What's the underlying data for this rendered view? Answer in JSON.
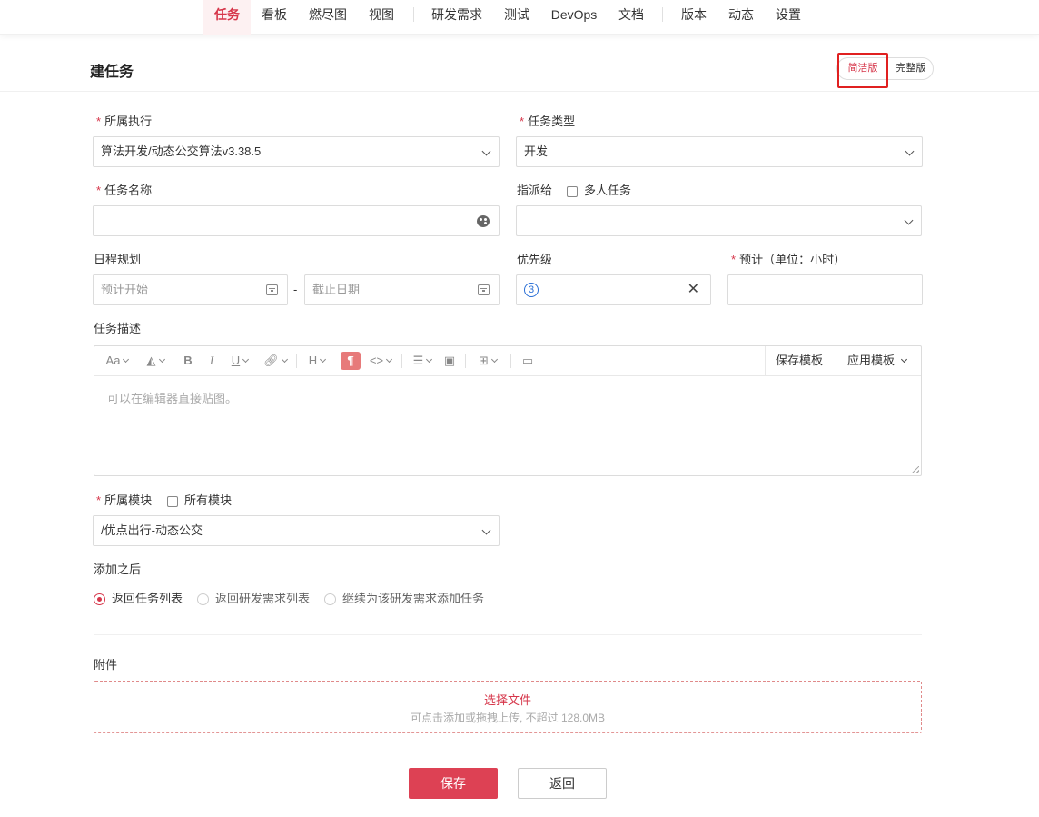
{
  "nav": {
    "items": [
      "任务",
      "看板",
      "燃尽图",
      "视图",
      "研发需求",
      "测试",
      "DevOps",
      "文档",
      "版本",
      "动态",
      "设置"
    ],
    "active": "任务"
  },
  "header": {
    "title": "建任务",
    "mode_simple": "简洁版",
    "mode_full": "完整版"
  },
  "form": {
    "execution": {
      "label": "所属执行",
      "value": "算法开发/动态公交算法v3.38.5"
    },
    "task_type": {
      "label": "任务类型",
      "value": "开发"
    },
    "task_name": {
      "label": "任务名称",
      "value": ""
    },
    "assign": {
      "label": "指派给",
      "multi_label": "多人任务",
      "value": ""
    },
    "schedule": {
      "label": "日程规划",
      "start_placeholder": "预计开始",
      "sep": "-",
      "end_placeholder": "截止日期"
    },
    "priority": {
      "label": "优先级",
      "value": "3"
    },
    "estimate": {
      "label": "预计（单位：小时）",
      "value": ""
    },
    "description": {
      "label": "任务描述",
      "toolbar": {
        "save_template": "保存模板",
        "apply_template": "应用模板"
      },
      "placeholder": "可以在编辑器直接贴图。"
    },
    "module": {
      "label": "所属模块",
      "all_label": "所有模块",
      "value": "/优点出行-动态公交"
    },
    "after_add": {
      "label": "添加之后",
      "options": [
        "返回任务列表",
        "返回研发需求列表",
        "继续为该研发需求添加任务"
      ],
      "selected": 0
    },
    "attachment": {
      "label": "附件",
      "select": "选择文件",
      "hint": "可点击添加或拖拽上传, 不超过 128.0MB"
    }
  },
  "footer": {
    "save": "保存",
    "back": "返回"
  },
  "colors": {
    "accent": "#d6364a",
    "save_bg": "#dd4154",
    "priority": "#2a6fd6",
    "highlight": "#e02020"
  },
  "icons": [
    "chevron-down-icon",
    "calendar-icon",
    "palette-icon",
    "clear-icon",
    "resize-grip-icon"
  ]
}
